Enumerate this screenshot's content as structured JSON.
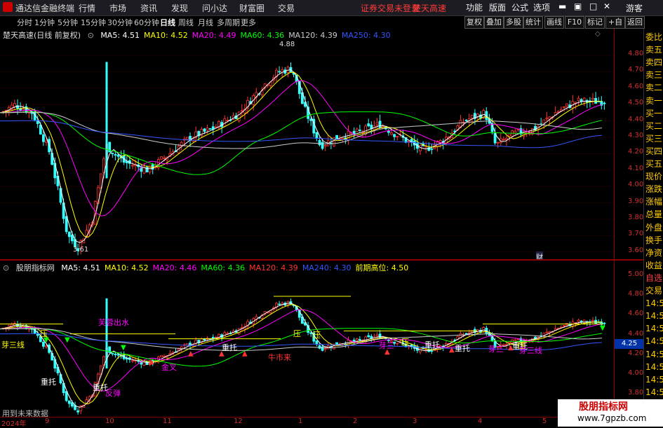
{
  "app": {
    "title": "通达信金融终端"
  },
  "menu": [
    "行情",
    "市场",
    "资讯",
    "发现",
    "问小达",
    "财富圈",
    "交易"
  ],
  "notice": {
    "login": "证券交易未登录",
    "stock": "楚天高速"
  },
  "toolbar_right": [
    "功能",
    "版面",
    "公式",
    "选项"
  ],
  "guest": "游客",
  "periods": [
    "分时",
    "1分钟",
    "5分钟",
    "15分钟",
    "30分钟",
    "60分钟",
    "日线",
    "周线",
    "月线",
    "多周期",
    "更多"
  ],
  "active_period": "日线",
  "tools": [
    "复权",
    "叠加",
    "多股",
    "统计",
    "画线",
    "F10",
    "标记",
    "+自选",
    "返回"
  ],
  "main_legend": {
    "name": "楚天高速(日线 前复权)",
    "items": [
      {
        "label": "MA5: 4.51",
        "color": "#ffffff"
      },
      {
        "label": "MA10: 4.52",
        "color": "#ffff00"
      },
      {
        "label": "MA20: 4.49",
        "color": "#ff00ff"
      },
      {
        "label": "MA60: 4.36",
        "color": "#00ff00"
      },
      {
        "label": "MA120: 4.39",
        "color": "#cccccc"
      },
      {
        "label": "MA250: 4.30",
        "color": "#3355ff"
      }
    ]
  },
  "main_axis": [
    "4.80",
    "4.70",
    "4.60",
    "4.50",
    "4.40",
    "4.30",
    "4.20",
    "4.10",
    "4.00",
    "3.90",
    "3.80",
    "3.70",
    "3.60"
  ],
  "main_marks": {
    "high": "4.88",
    "low": "3.61",
    "fin": "财"
  },
  "sub_legend": {
    "name": "股朋指标网",
    "items": [
      {
        "label": "MA5: 4.51",
        "color": "#ffffff"
      },
      {
        "label": "MA10: 4.52",
        "color": "#ffff00"
      },
      {
        "label": "MA20: 4.46",
        "color": "#ff00ff"
      },
      {
        "label": "MA60: 4.36",
        "color": "#00ff00"
      },
      {
        "label": "MA120: 4.39",
        "color": "#ff3333"
      },
      {
        "label": "MA240: 4.30",
        "color": "#3355ff"
      },
      {
        "label": "前期高位: 4.50",
        "color": "#ffff00"
      }
    ]
  },
  "sub_axis": [
    "5.00",
    "4.80",
    "4.60",
    "4.40",
    "4.20",
    "4.00",
    "3.80"
  ],
  "sub_price_tag": "4.25",
  "sub_labels": [
    {
      "text": "芽三线",
      "color": "#ffff00"
    },
    {
      "text": "压",
      "color": "#ffff00"
    },
    {
      "text": "芙蓉出水",
      "color": "#ff00ff"
    },
    {
      "text": "重托",
      "color": "#ffffff"
    },
    {
      "text": "重托",
      "color": "#ffffff"
    },
    {
      "text": "反弹",
      "color": "#ff00ff"
    },
    {
      "text": "金叉",
      "color": "#ff00ff"
    },
    {
      "text": "重托",
      "color": "#ffffff"
    },
    {
      "text": "牛市来",
      "color": "#ff3333"
    },
    {
      "text": "压",
      "color": "#ffff00"
    },
    {
      "text": "压",
      "color": "#ffff00"
    },
    {
      "text": "芽三",
      "color": "#ff00ff"
    },
    {
      "text": "压",
      "color": "#ffff00"
    },
    {
      "text": "重托",
      "color": "#ffffff"
    },
    {
      "text": "重托",
      "color": "#ffffff"
    },
    {
      "text": "芽三",
      "color": "#ff00ff"
    },
    {
      "text": "重托",
      "color": "#ffffff"
    },
    {
      "text": "压",
      "color": "#ffff00"
    },
    {
      "text": "芽三线",
      "color": "#ff00ff"
    }
  ],
  "future_note": "用到未来数据",
  "date_axis": [
    "2024年",
    "9",
    "10",
    "11",
    "12",
    "1",
    "2",
    "3",
    "4",
    "5"
  ],
  "sidebar": [
    {
      "text": "委比",
      "color": "#ffcc00"
    },
    {
      "text": "卖五",
      "color": "#ffcc00"
    },
    {
      "text": "卖四",
      "color": "#ffcc00"
    },
    {
      "text": "卖三",
      "color": "#ffcc00"
    },
    {
      "text": "卖二",
      "color": "#ffcc00"
    },
    {
      "text": "卖一",
      "color": "#ffcc00"
    },
    {
      "text": "买一",
      "color": "#ffcc00"
    },
    {
      "text": "买二",
      "color": "#ffcc00"
    },
    {
      "text": "买三",
      "color": "#ffcc00"
    },
    {
      "text": "买四",
      "color": "#ffcc00"
    },
    {
      "text": "买五",
      "color": "#ffcc00"
    },
    {
      "text": "现价",
      "color": "#ffcc00"
    },
    {
      "text": "涨跌",
      "color": "#ffcc00"
    },
    {
      "text": "涨幅",
      "color": "#ffcc00"
    },
    {
      "text": "总量",
      "color": "#ffcc00"
    },
    {
      "text": "外盘",
      "color": "#ffcc00"
    },
    {
      "text": "换手",
      "color": "#ffcc00"
    },
    {
      "text": "净资",
      "color": "#ffcc00"
    },
    {
      "text": "收益",
      "color": "#ffcc00"
    },
    {
      "text": "自选",
      "color": "#ff4040"
    },
    {
      "text": "交易",
      "color": "#ffcc00"
    },
    {
      "text": "14:5",
      "color": "#ffcc00"
    },
    {
      "text": "14:5",
      "color": "#ffcc00"
    },
    {
      "text": "14:5",
      "color": "#ffcc00"
    },
    {
      "text": "14:5",
      "color": "#ffcc00"
    },
    {
      "text": "14:5",
      "color": "#ffcc00"
    },
    {
      "text": "14:5",
      "color": "#ffcc00"
    },
    {
      "text": "14:5",
      "color": "#ffcc00"
    },
    {
      "text": "14:5",
      "color": "#ffcc00"
    },
    {
      "text": "14:5",
      "color": "#ffcc00"
    },
    {
      "text": "14:5",
      "color": "#ffcc00"
    }
  ],
  "watermark": {
    "title": "股朋指标网",
    "url": "www.7gpzb.com"
  }
}
